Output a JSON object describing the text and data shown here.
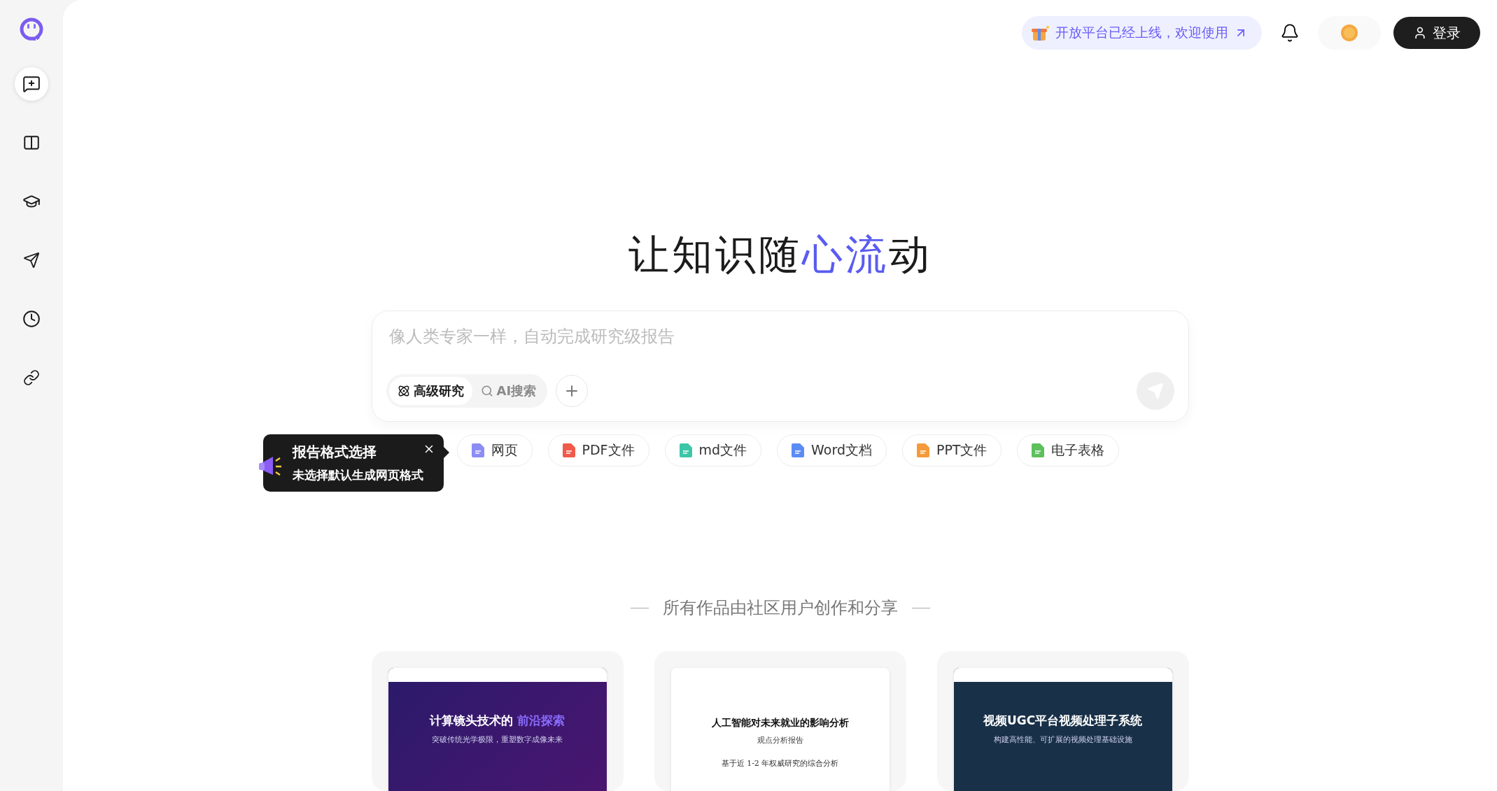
{
  "sidebar": {
    "items": [
      {
        "kind": "new-chat",
        "selected": true
      },
      {
        "kind": "library",
        "selected": false
      },
      {
        "kind": "learn",
        "selected": false
      },
      {
        "kind": "send",
        "selected": false
      },
      {
        "kind": "history",
        "selected": false
      },
      {
        "kind": "link",
        "selected": false
      }
    ]
  },
  "top_bar": {
    "announcement": "开放平台已经上线，欢迎使用",
    "login": "登录"
  },
  "hero": {
    "title": [
      {
        "text": "让知识随",
        "highlight": false
      },
      {
        "text": "心流",
        "highlight": true
      },
      {
        "text": "动",
        "highlight": false
      }
    ]
  },
  "composer": {
    "placeholder": "像人类专家一样，自动完成研究级报告",
    "modes": [
      {
        "kind": "research",
        "label": "高级研究",
        "selected": true
      },
      {
        "kind": "search",
        "label": "AI搜索",
        "selected": false
      }
    ]
  },
  "tooltip": {
    "title": "报告格式选择",
    "body": "未选择默认生成网页格式"
  },
  "formats": [
    {
      "kind": "web",
      "label": "网页"
    },
    {
      "kind": "pdf",
      "label": "PDF文件"
    },
    {
      "kind": "md",
      "label": "md文件"
    },
    {
      "kind": "word",
      "label": "Word文档"
    },
    {
      "kind": "ppt",
      "label": "PPT文件"
    },
    {
      "kind": "sheet",
      "label": "电子表格"
    }
  ],
  "community": {
    "label": "所有作品由社区用户创作和分享",
    "cards": [
      {
        "kind": "dark-purple",
        "title": "计算镜头技术的 **前沿探索**",
        "subtitle": "突破传统光学极限，重塑数字成像未来"
      },
      {
        "kind": "paper",
        "title": "人工智能对未来就业的影响分析",
        "subtitle": "观点分析报告",
        "note": "基于近 1-2 年权威研究的综合分析"
      },
      {
        "kind": "dark-blue",
        "title": "视频UGC平台视频处理子系统",
        "subtitle": "构建高性能、可扩展的视频处理基础设施"
      }
    ]
  }
}
